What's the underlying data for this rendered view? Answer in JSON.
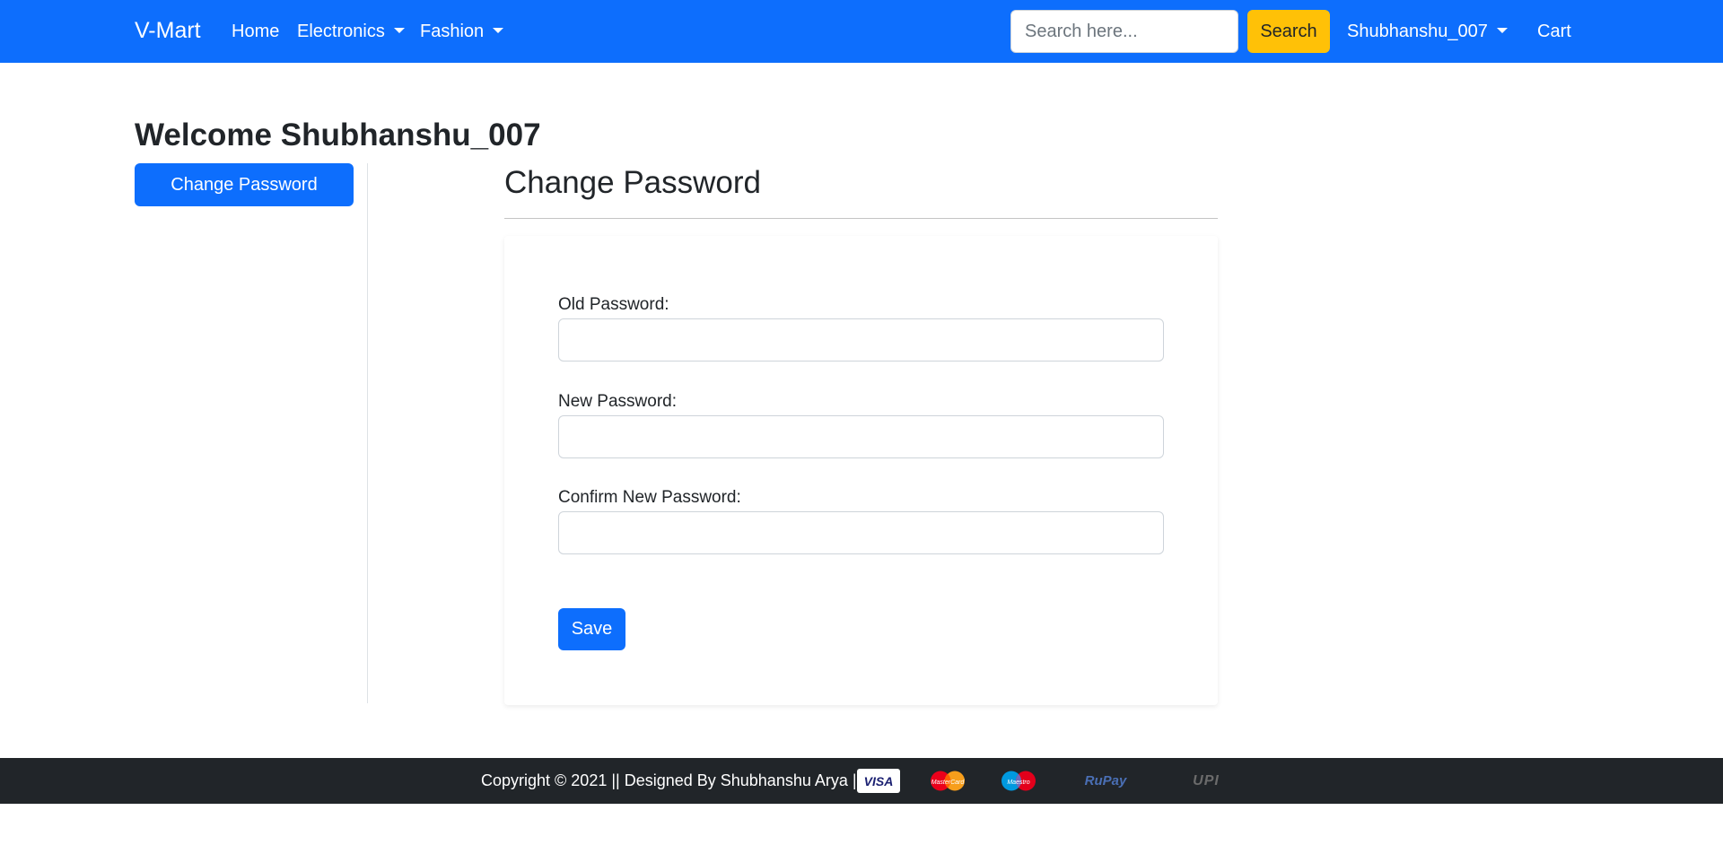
{
  "navbar": {
    "brand": "V-Mart",
    "links": [
      {
        "label": "Home",
        "has_dropdown": false
      },
      {
        "label": "Electronics",
        "has_dropdown": true
      },
      {
        "label": "Fashion",
        "has_dropdown": true
      }
    ],
    "search": {
      "placeholder": "Search here...",
      "value": "",
      "button_label": "Search"
    },
    "user_menu": {
      "label": "Shubhanshu_007",
      "has_dropdown": true
    },
    "cart_label": "Cart",
    "colors": {
      "primary": "#0d6efd",
      "search_button": "#ffc107"
    }
  },
  "main": {
    "welcome": "Welcome Shubhanshu_007",
    "sidebar": {
      "items": [
        {
          "label": "Change Password",
          "active": true
        }
      ]
    },
    "section_title": "Change Password",
    "form": {
      "fields": [
        {
          "label": "Old Password:",
          "value": ""
        },
        {
          "label": "New Password:",
          "value": ""
        },
        {
          "label": "Confirm New Password:",
          "value": ""
        }
      ],
      "save_label": "Save"
    }
  },
  "footer": {
    "copyright": "Copyright © 2021 || Designed By Shubhanshu Arya ||",
    "payment_methods": [
      {
        "name": "visa-icon",
        "text": "VISA"
      },
      {
        "name": "mastercard-icon",
        "text": "MasterCard"
      },
      {
        "name": "maestro-icon",
        "text": "Maestro"
      },
      {
        "name": "rupay-icon",
        "text": "RuPay"
      },
      {
        "name": "upi-icon",
        "text": "UPI"
      }
    ],
    "background": "#212529"
  }
}
